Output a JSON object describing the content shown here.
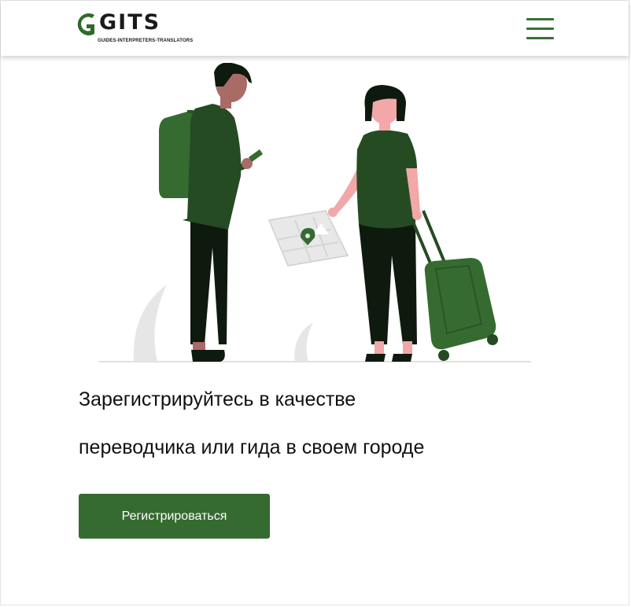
{
  "header": {
    "logo": {
      "wordmark": "GITS",
      "tagline": "GUIDES-INTERPRETERS-TRANSLATORS"
    },
    "menu_icon": "hamburger-menu-icon"
  },
  "hero": {
    "illustration": "travelers-with-map-and-suitcase-illustration",
    "headline_line1": "Зарегистрируйтесь в качестве",
    "headline_line2": "переводчика или гида в своем городе",
    "register_label": "Регистрироваться"
  },
  "colors": {
    "brand_green": "#356b30",
    "dark_green": "#254b22",
    "text": "#111111"
  }
}
